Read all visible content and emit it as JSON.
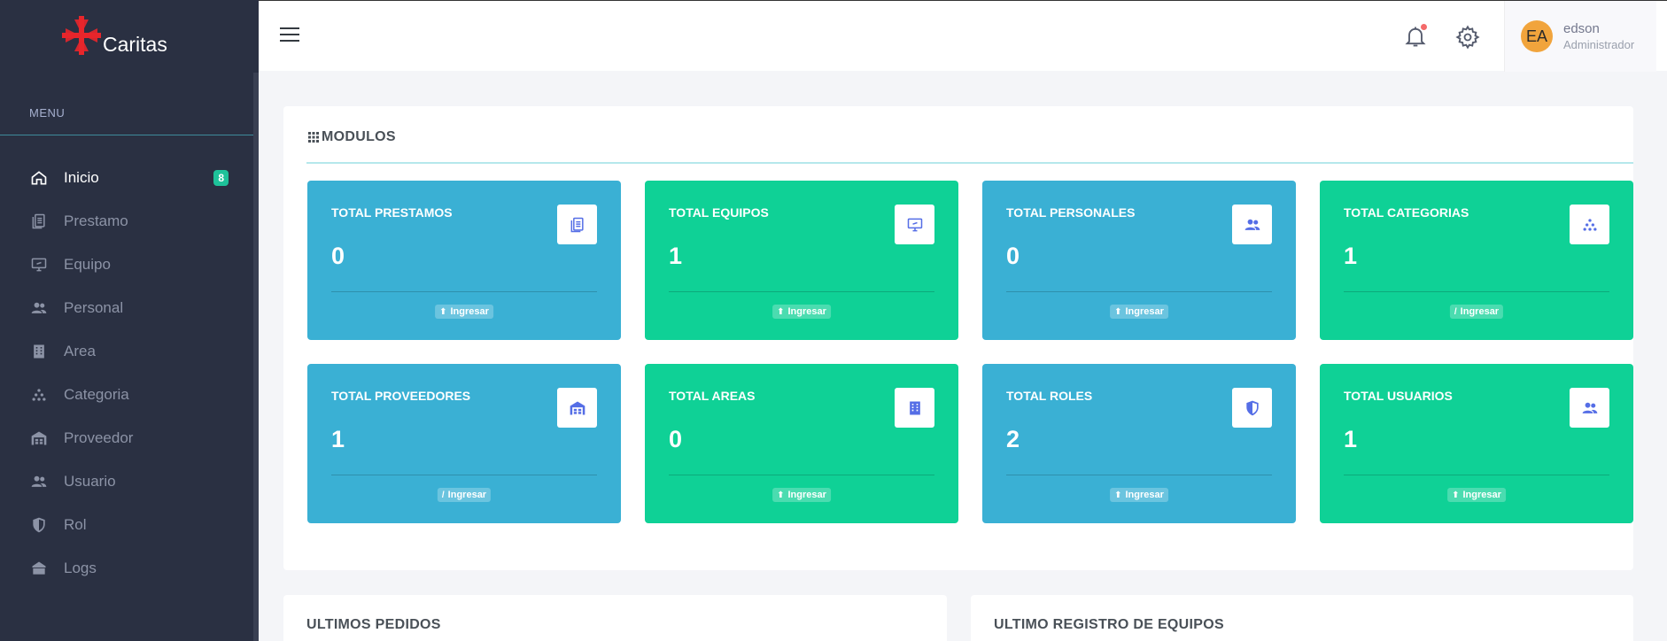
{
  "brand": {
    "name": "Caritas"
  },
  "sidebar": {
    "menu_title": "MENU",
    "items": [
      {
        "label": "Inicio",
        "icon": "home-icon",
        "badge": "8",
        "active": true
      },
      {
        "label": "Prestamo",
        "icon": "document-icon"
      },
      {
        "label": "Equipo",
        "icon": "monitor-icon"
      },
      {
        "label": "Personal",
        "icon": "users-icon"
      },
      {
        "label": "Area",
        "icon": "building-icon"
      },
      {
        "label": "Categoria",
        "icon": "category-icon"
      },
      {
        "label": "Proveedor",
        "icon": "warehouse-icon"
      },
      {
        "label": "Usuario",
        "icon": "users-icon"
      },
      {
        "label": "Rol",
        "icon": "shield-icon"
      },
      {
        "label": "Logs",
        "icon": "log-icon"
      }
    ]
  },
  "topbar": {
    "user": {
      "initials": "EA",
      "name": "edson",
      "role": "Administrador"
    }
  },
  "modules": {
    "title": "MODULOS",
    "tiles": [
      {
        "label": "TOTAL PRESTAMOS",
        "value": "0",
        "button": "Ingresar",
        "button_icon": "arrow-up-icon",
        "color": "#3ab0d4",
        "icon": "document-icon"
      },
      {
        "label": "TOTAL EQUIPOS",
        "value": "1",
        "button": "Ingresar",
        "button_icon": "arrow-up-icon",
        "color": "#0fd196",
        "icon": "monitor-icon"
      },
      {
        "label": "TOTAL PERSONALES",
        "value": "0",
        "button": "Ingresar",
        "button_icon": "arrow-up-icon",
        "color": "#3ab0d4",
        "icon": "users-icon"
      },
      {
        "label": "TOTAL CATEGORIAS",
        "value": "1",
        "button": "Ingresar",
        "button_icon": "slash-icon",
        "color": "#0fd196",
        "icon": "category-icon"
      },
      {
        "label": "TOTAL PROVEEDORES",
        "value": "1",
        "button": "Ingresar",
        "button_icon": "slash-icon",
        "color": "#3ab0d4",
        "icon": "warehouse-icon"
      },
      {
        "label": "TOTAL AREAS",
        "value": "0",
        "button": "Ingresar",
        "button_icon": "arrow-up-icon",
        "color": "#0fd196",
        "icon": "building-icon"
      },
      {
        "label": "TOTAL ROLES",
        "value": "2",
        "button": "Ingresar",
        "button_icon": "arrow-up-icon",
        "color": "#3ab0d4",
        "icon": "shield-icon"
      },
      {
        "label": "TOTAL USUARIOS",
        "value": "1",
        "button": "Ingresar",
        "button_icon": "arrow-up-icon",
        "color": "#0fd196",
        "icon": "users-icon"
      }
    ]
  },
  "bottom": {
    "left_title": "ULTIMOS PEDIDOS",
    "right_title": "ULTIMO REGISTRO DE EQUIPOS"
  },
  "colors": {
    "sidebar_bg": "#2a3042",
    "tile_blue": "#3ab0d4",
    "tile_green": "#0fd196",
    "badge": "#1ec29a",
    "icon_accent": "#556ee6",
    "logo_red": "#e8262b"
  }
}
